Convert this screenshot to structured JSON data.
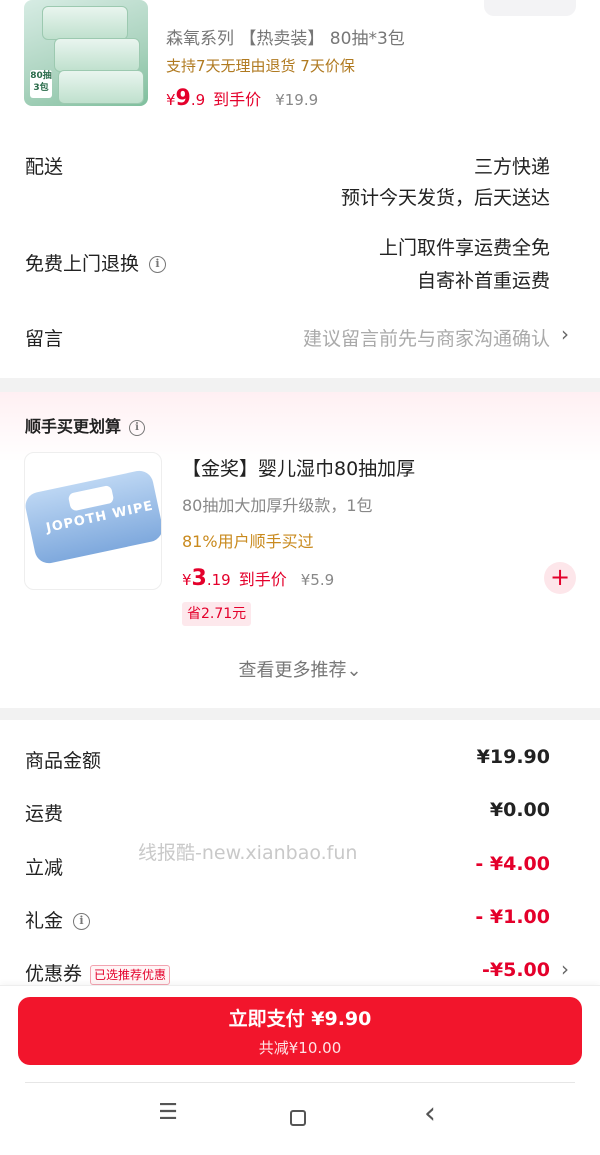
{
  "product": {
    "title": "森氧系列 【热卖装】 80抽*3包",
    "service": "支持7天无理由退货 7天价保",
    "price_symbol": "¥",
    "price_int": "9",
    "price_dec": ".9",
    "price_suffix": "到手价",
    "original_price": "¥19.9",
    "thumb_badge_line1": "80抽",
    "thumb_badge_line2": "3包"
  },
  "delivery": {
    "label": "配送",
    "value_line1": "三方快递",
    "value_line2": "预计今天发货，后天送达"
  },
  "return_service": {
    "label": "免费上门退换",
    "info_icon": "i",
    "value_line1": "上门取件享运费全免",
    "value_line2": "自寄补首重运费"
  },
  "message": {
    "label": "留言",
    "placeholder": "建议留言前先与商家沟通确认"
  },
  "recommend": {
    "header": "顺手买更划算",
    "info_icon": "i",
    "item": {
      "pack_text": "JOPOTH WIPE",
      "title": "【金奖】婴儿湿巾80抽加厚",
      "subtitle": "80抽加大加厚升级款，1包",
      "bought": "81%用户顺手买过",
      "price_symbol": "¥",
      "price_int": "3",
      "price_dec": ".19",
      "price_suffix": "到手价",
      "original_price": "¥5.9",
      "save": "省2.71元",
      "add_symbol": "+"
    },
    "more_link": "查看更多推荐⌄"
  },
  "summary": {
    "goods_label": "商品金额",
    "goods_value": "¥19.90",
    "shipping_label": "运费",
    "shipping_value": "¥0.00",
    "discount_label": "立减",
    "discount_value": "- ¥4.00",
    "gift_label": "礼金",
    "gift_info_icon": "i",
    "gift_value": "- ¥1.00",
    "coupon_label": "优惠券",
    "coupon_tag": "已选推荐优惠",
    "coupon_value": "-¥5.00"
  },
  "watermark": "线报酷-new.xianbao.fun",
  "pay": {
    "main": "立即支付 ¥9.90",
    "sub": "共减¥10.00"
  },
  "nav": {
    "menu_glyph": "☰",
    "back_glyph": "‹"
  },
  "colors": {
    "accent_red": "#e4002b",
    "pay_button": "#f2152c",
    "service_gold": "#b07a20"
  }
}
